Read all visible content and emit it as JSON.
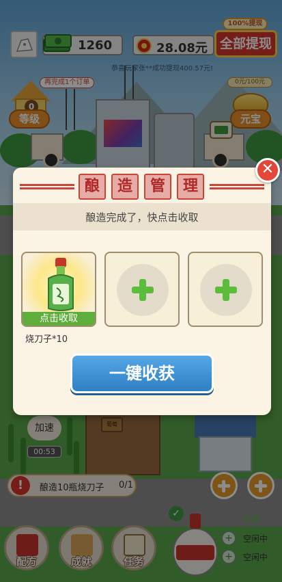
{
  "hud": {
    "money": "1260",
    "rmb": "28.08元",
    "withdraw_badge": "100%提现",
    "withdraw_all": "全部提现",
    "ticker": "恭喜玩家张**成功提现400.57元!",
    "order_tip": "再完成1个订单",
    "level_num": "0",
    "level_label": "等级",
    "yuanbao_progress": "0元/100元",
    "yuanbao_label": "元宝"
  },
  "modal": {
    "title_chars": [
      "酿",
      "造",
      "管",
      "理"
    ],
    "subtitle": "酿造完成了，快点击收取",
    "slot1_action": "点击收取",
    "slot1_caption": "烧刀子*10",
    "harvest_button": "一键收获",
    "close": "✕"
  },
  "bottom": {
    "speed": "加速",
    "timer": "00:53",
    "task_text": "酿造10瓶烧刀子",
    "task_count": "0/1",
    "farm_sign": "葡萄",
    "nav": [
      "配方",
      "成就",
      "任务"
    ],
    "queue_done": "完成",
    "queue_idle": [
      "空闲中",
      "空闲中"
    ]
  },
  "colors": {
    "accent_red": "#d8352a",
    "harvest_blue": "#2f7fc4",
    "plus_green": "#5bbd3a"
  }
}
